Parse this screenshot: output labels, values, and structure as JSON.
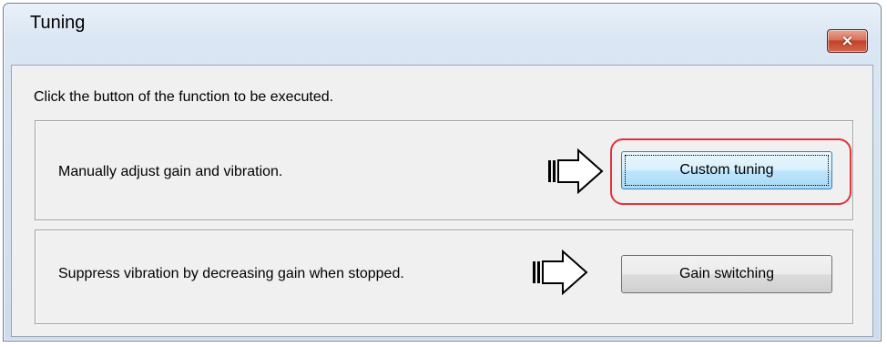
{
  "window": {
    "title": "Tuning",
    "close_symbol": "×",
    "close_icon": "close-icon"
  },
  "dialog": {
    "instruction": "Click the button of the function to be executed.",
    "groups": [
      {
        "description": "Manually adjust gain and vibration.",
        "arrow_icon": "right-arrow-icon",
        "button_label": "Custom tuning",
        "focused": true,
        "highlighted": true
      },
      {
        "description": "Suppress vibration by decreasing gain when stopped.",
        "arrow_icon": "right-arrow-icon",
        "button_label": "Gain switching",
        "focused": false,
        "highlighted": false
      }
    ]
  },
  "colors": {
    "highlight": "#e0333a",
    "close_button": "#c2412a",
    "focused_button": "#bee6fd"
  }
}
